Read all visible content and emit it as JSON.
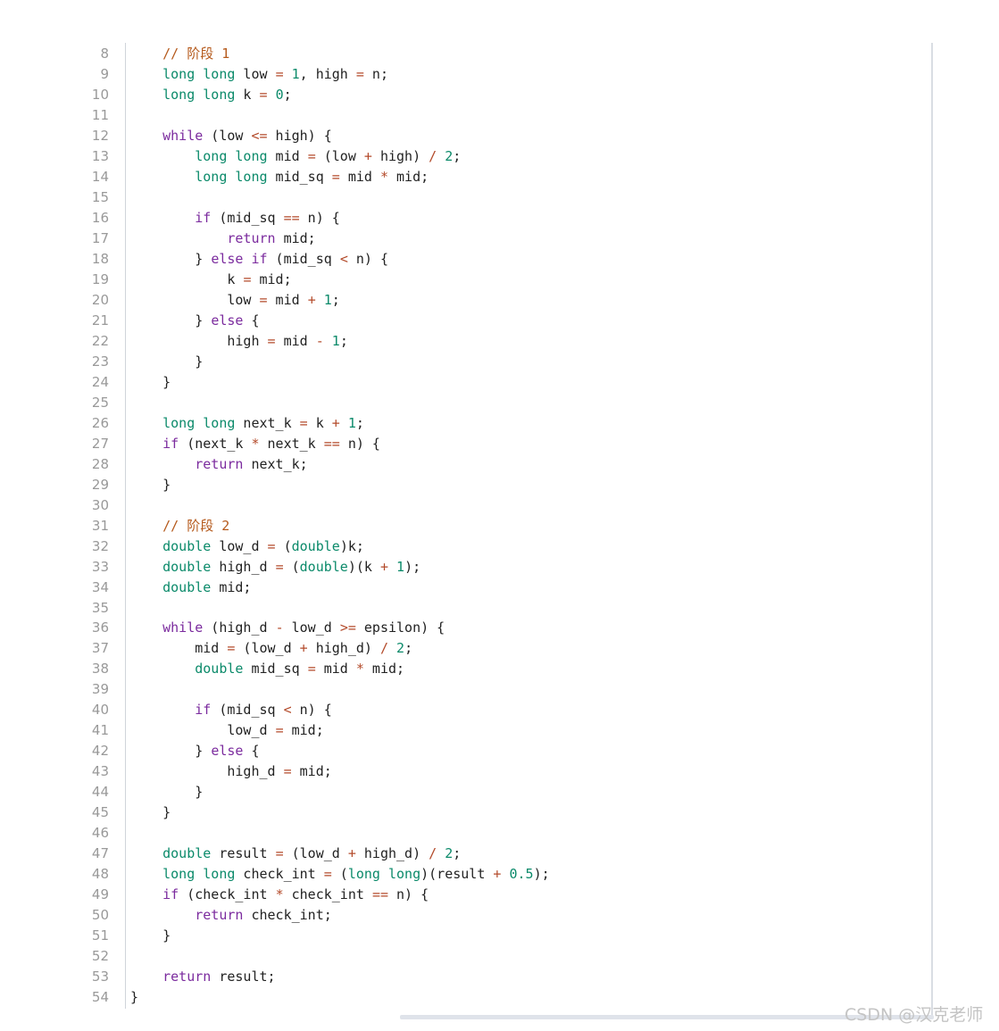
{
  "watermark": "CSDN @汉克老师",
  "colors": {
    "comment": "#b55a1c",
    "type": "#0b8a6a",
    "keyword": "#7b2b9e",
    "number": "#0b8a6a",
    "operator": "#b34a2a",
    "plain": "#222222",
    "line_number": "#999999"
  },
  "code_lines": [
    {
      "n": "8",
      "tokens": [
        [
          "    ",
          "plain"
        ],
        [
          "// 阶段 1",
          "comment"
        ]
      ]
    },
    {
      "n": "9",
      "tokens": [
        [
          "    ",
          "plain"
        ],
        [
          "long long",
          "type"
        ],
        [
          " low ",
          "plain"
        ],
        [
          "=",
          "op"
        ],
        [
          " ",
          "plain"
        ],
        [
          "1",
          "num"
        ],
        [
          ", high ",
          "plain"
        ],
        [
          "=",
          "op"
        ],
        [
          " n;",
          "plain"
        ]
      ]
    },
    {
      "n": "10",
      "tokens": [
        [
          "    ",
          "plain"
        ],
        [
          "long long",
          "type"
        ],
        [
          " k ",
          "plain"
        ],
        [
          "=",
          "op"
        ],
        [
          " ",
          "plain"
        ],
        [
          "0",
          "num"
        ],
        [
          ";",
          "plain"
        ]
      ]
    },
    {
      "n": "11",
      "tokens": []
    },
    {
      "n": "12",
      "tokens": [
        [
          "    ",
          "plain"
        ],
        [
          "while",
          "kw"
        ],
        [
          " (low ",
          "plain"
        ],
        [
          "<=",
          "op"
        ],
        [
          " high) {",
          "plain"
        ]
      ]
    },
    {
      "n": "13",
      "tokens": [
        [
          "        ",
          "plain"
        ],
        [
          "long long",
          "type"
        ],
        [
          " mid ",
          "plain"
        ],
        [
          "=",
          "op"
        ],
        [
          " (low ",
          "plain"
        ],
        [
          "+",
          "op"
        ],
        [
          " high) ",
          "plain"
        ],
        [
          "/",
          "op"
        ],
        [
          " ",
          "plain"
        ],
        [
          "2",
          "num"
        ],
        [
          ";",
          "plain"
        ]
      ]
    },
    {
      "n": "14",
      "tokens": [
        [
          "        ",
          "plain"
        ],
        [
          "long long",
          "type"
        ],
        [
          " mid_sq ",
          "plain"
        ],
        [
          "=",
          "op"
        ],
        [
          " mid ",
          "plain"
        ],
        [
          "*",
          "op"
        ],
        [
          " mid;",
          "plain"
        ]
      ]
    },
    {
      "n": "15",
      "tokens": []
    },
    {
      "n": "16",
      "tokens": [
        [
          "        ",
          "plain"
        ],
        [
          "if",
          "kw"
        ],
        [
          " (mid_sq ",
          "plain"
        ],
        [
          "==",
          "op"
        ],
        [
          " n) {",
          "plain"
        ]
      ]
    },
    {
      "n": "17",
      "tokens": [
        [
          "            ",
          "plain"
        ],
        [
          "return",
          "kw"
        ],
        [
          " mid;",
          "plain"
        ]
      ]
    },
    {
      "n": "18",
      "tokens": [
        [
          "        } ",
          "plain"
        ],
        [
          "else if",
          "kw"
        ],
        [
          " (mid_sq ",
          "plain"
        ],
        [
          "<",
          "op"
        ],
        [
          " n) {",
          "plain"
        ]
      ]
    },
    {
      "n": "19",
      "tokens": [
        [
          "            k ",
          "plain"
        ],
        [
          "=",
          "op"
        ],
        [
          " mid;",
          "plain"
        ]
      ]
    },
    {
      "n": "20",
      "tokens": [
        [
          "            low ",
          "plain"
        ],
        [
          "=",
          "op"
        ],
        [
          " mid ",
          "plain"
        ],
        [
          "+",
          "op"
        ],
        [
          " ",
          "plain"
        ],
        [
          "1",
          "num"
        ],
        [
          ";",
          "plain"
        ]
      ]
    },
    {
      "n": "21",
      "tokens": [
        [
          "        } ",
          "plain"
        ],
        [
          "else",
          "kw"
        ],
        [
          " {",
          "plain"
        ]
      ]
    },
    {
      "n": "22",
      "tokens": [
        [
          "            high ",
          "plain"
        ],
        [
          "=",
          "op"
        ],
        [
          " mid ",
          "plain"
        ],
        [
          "-",
          "op"
        ],
        [
          " ",
          "plain"
        ],
        [
          "1",
          "num"
        ],
        [
          ";",
          "plain"
        ]
      ]
    },
    {
      "n": "23",
      "tokens": [
        [
          "        }",
          "plain"
        ]
      ]
    },
    {
      "n": "24",
      "tokens": [
        [
          "    }",
          "plain"
        ]
      ]
    },
    {
      "n": "25",
      "tokens": []
    },
    {
      "n": "26",
      "tokens": [
        [
          "    ",
          "plain"
        ],
        [
          "long long",
          "type"
        ],
        [
          " next_k ",
          "plain"
        ],
        [
          "=",
          "op"
        ],
        [
          " k ",
          "plain"
        ],
        [
          "+",
          "op"
        ],
        [
          " ",
          "plain"
        ],
        [
          "1",
          "num"
        ],
        [
          ";",
          "plain"
        ]
      ]
    },
    {
      "n": "27",
      "tokens": [
        [
          "    ",
          "plain"
        ],
        [
          "if",
          "kw"
        ],
        [
          " (next_k ",
          "plain"
        ],
        [
          "*",
          "op"
        ],
        [
          " next_k ",
          "plain"
        ],
        [
          "==",
          "op"
        ],
        [
          " n) {",
          "plain"
        ]
      ]
    },
    {
      "n": "28",
      "tokens": [
        [
          "        ",
          "plain"
        ],
        [
          "return",
          "kw"
        ],
        [
          " next_k;",
          "plain"
        ]
      ]
    },
    {
      "n": "29",
      "tokens": [
        [
          "    }",
          "plain"
        ]
      ]
    },
    {
      "n": "30",
      "tokens": []
    },
    {
      "n": "31",
      "tokens": [
        [
          "    ",
          "plain"
        ],
        [
          "// 阶段 2",
          "comment"
        ]
      ]
    },
    {
      "n": "32",
      "tokens": [
        [
          "    ",
          "plain"
        ],
        [
          "double",
          "type"
        ],
        [
          " low_d ",
          "plain"
        ],
        [
          "=",
          "op"
        ],
        [
          " (",
          "plain"
        ],
        [
          "double",
          "type"
        ],
        [
          ")k;",
          "plain"
        ]
      ]
    },
    {
      "n": "33",
      "tokens": [
        [
          "    ",
          "plain"
        ],
        [
          "double",
          "type"
        ],
        [
          " high_d ",
          "plain"
        ],
        [
          "=",
          "op"
        ],
        [
          " (",
          "plain"
        ],
        [
          "double",
          "type"
        ],
        [
          ")(k ",
          "plain"
        ],
        [
          "+",
          "op"
        ],
        [
          " ",
          "plain"
        ],
        [
          "1",
          "num"
        ],
        [
          ");",
          "plain"
        ]
      ]
    },
    {
      "n": "34",
      "tokens": [
        [
          "    ",
          "plain"
        ],
        [
          "double",
          "type"
        ],
        [
          " mid;",
          "plain"
        ]
      ]
    },
    {
      "n": "35",
      "tokens": []
    },
    {
      "n": "36",
      "tokens": [
        [
          "    ",
          "plain"
        ],
        [
          "while",
          "kw"
        ],
        [
          " (high_d ",
          "plain"
        ],
        [
          "-",
          "op"
        ],
        [
          " low_d ",
          "plain"
        ],
        [
          ">=",
          "op"
        ],
        [
          " epsilon) {",
          "plain"
        ]
      ]
    },
    {
      "n": "37",
      "tokens": [
        [
          "        mid ",
          "plain"
        ],
        [
          "=",
          "op"
        ],
        [
          " (low_d ",
          "plain"
        ],
        [
          "+",
          "op"
        ],
        [
          " high_d) ",
          "plain"
        ],
        [
          "/",
          "op"
        ],
        [
          " ",
          "plain"
        ],
        [
          "2",
          "num"
        ],
        [
          ";",
          "plain"
        ]
      ]
    },
    {
      "n": "38",
      "tokens": [
        [
          "        ",
          "plain"
        ],
        [
          "double",
          "type"
        ],
        [
          " mid_sq ",
          "plain"
        ],
        [
          "=",
          "op"
        ],
        [
          " mid ",
          "plain"
        ],
        [
          "*",
          "op"
        ],
        [
          " mid;",
          "plain"
        ]
      ]
    },
    {
      "n": "39",
      "tokens": []
    },
    {
      "n": "40",
      "tokens": [
        [
          "        ",
          "plain"
        ],
        [
          "if",
          "kw"
        ],
        [
          " (mid_sq ",
          "plain"
        ],
        [
          "<",
          "op"
        ],
        [
          " n) {",
          "plain"
        ]
      ]
    },
    {
      "n": "41",
      "tokens": [
        [
          "            low_d ",
          "plain"
        ],
        [
          "=",
          "op"
        ],
        [
          " mid;",
          "plain"
        ]
      ]
    },
    {
      "n": "42",
      "tokens": [
        [
          "        } ",
          "plain"
        ],
        [
          "else",
          "kw"
        ],
        [
          " {",
          "plain"
        ]
      ]
    },
    {
      "n": "43",
      "tokens": [
        [
          "            high_d ",
          "plain"
        ],
        [
          "=",
          "op"
        ],
        [
          " mid;",
          "plain"
        ]
      ]
    },
    {
      "n": "44",
      "tokens": [
        [
          "        }",
          "plain"
        ]
      ]
    },
    {
      "n": "45",
      "tokens": [
        [
          "    }",
          "plain"
        ]
      ]
    },
    {
      "n": "46",
      "tokens": []
    },
    {
      "n": "47",
      "tokens": [
        [
          "    ",
          "plain"
        ],
        [
          "double",
          "type"
        ],
        [
          " result ",
          "plain"
        ],
        [
          "=",
          "op"
        ],
        [
          " (low_d ",
          "plain"
        ],
        [
          "+",
          "op"
        ],
        [
          " high_d) ",
          "plain"
        ],
        [
          "/",
          "op"
        ],
        [
          " ",
          "plain"
        ],
        [
          "2",
          "num"
        ],
        [
          ";",
          "plain"
        ]
      ]
    },
    {
      "n": "48",
      "tokens": [
        [
          "    ",
          "plain"
        ],
        [
          "long long",
          "type"
        ],
        [
          " check_int ",
          "plain"
        ],
        [
          "=",
          "op"
        ],
        [
          " (",
          "plain"
        ],
        [
          "long long",
          "type"
        ],
        [
          ")(result ",
          "plain"
        ],
        [
          "+",
          "op"
        ],
        [
          " ",
          "plain"
        ],
        [
          "0.5",
          "num"
        ],
        [
          ");",
          "plain"
        ]
      ]
    },
    {
      "n": "49",
      "tokens": [
        [
          "    ",
          "plain"
        ],
        [
          "if",
          "kw"
        ],
        [
          " (check_int ",
          "plain"
        ],
        [
          "*",
          "op"
        ],
        [
          " check_int ",
          "plain"
        ],
        [
          "==",
          "op"
        ],
        [
          " n) {",
          "plain"
        ]
      ]
    },
    {
      "n": "50",
      "tokens": [
        [
          "        ",
          "plain"
        ],
        [
          "return",
          "kw"
        ],
        [
          " check_int;",
          "plain"
        ]
      ]
    },
    {
      "n": "51",
      "tokens": [
        [
          "    }",
          "plain"
        ]
      ]
    },
    {
      "n": "52",
      "tokens": []
    },
    {
      "n": "53",
      "tokens": [
        [
          "    ",
          "plain"
        ],
        [
          "return",
          "kw"
        ],
        [
          " result;",
          "plain"
        ]
      ]
    },
    {
      "n": "54",
      "tokens": [
        [
          "}",
          "plain"
        ]
      ]
    }
  ]
}
